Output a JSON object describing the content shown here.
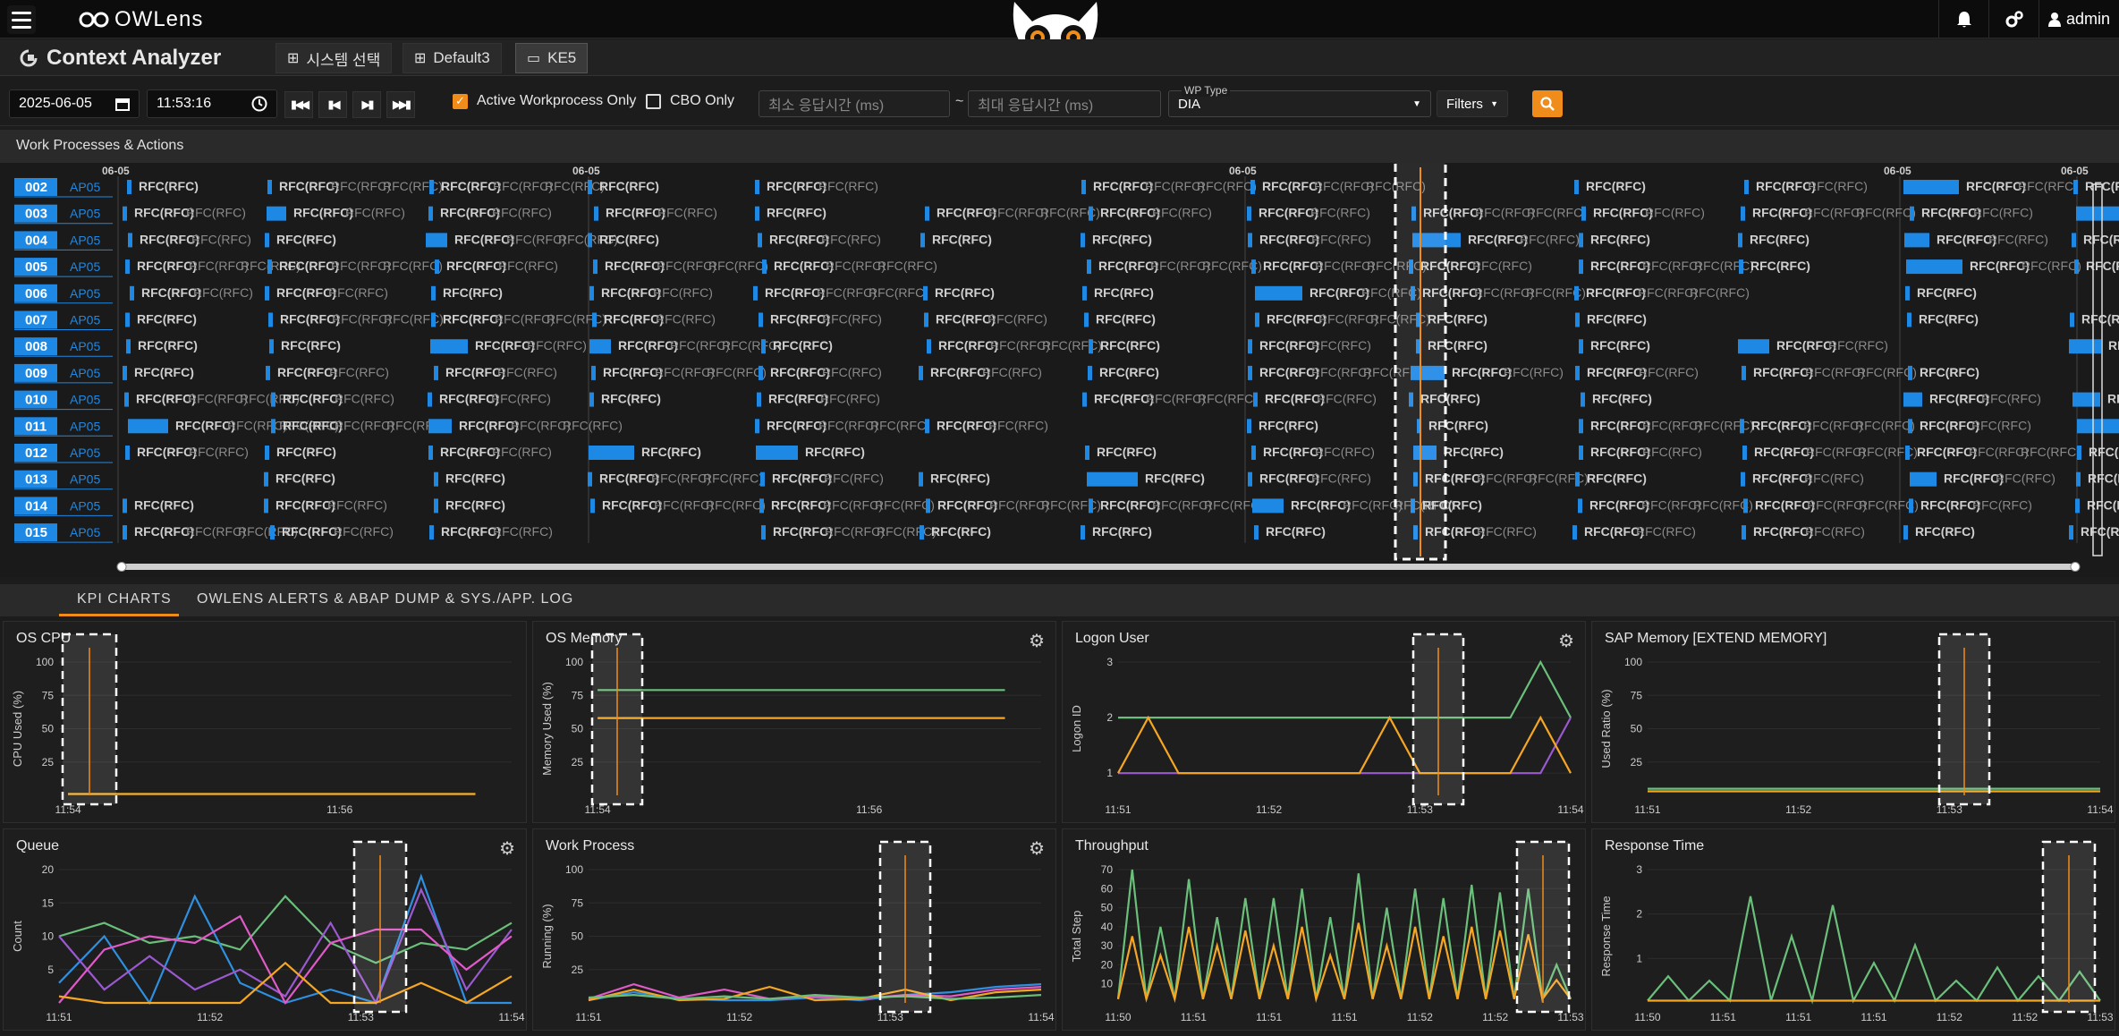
{
  "app": {
    "title": "OWLens"
  },
  "topbar": {
    "admin_label": "admin"
  },
  "subbar": {
    "title": "Context Analyzer",
    "tabs": [
      {
        "label": "시스템 선택"
      },
      {
        "label": "Default3"
      },
      {
        "label": "KE5"
      }
    ]
  },
  "toolbar": {
    "date": "2025-06-05",
    "time": "11:53:16",
    "active_wp_label": "Active Workprocess Only",
    "active_wp_checked": true,
    "cbo_label": "CBO Only",
    "cbo_checked": false,
    "min_resp_placeholder": "최소 응답시간 (ms)",
    "tilde": "~",
    "max_resp_placeholder": "최대 응답시간 (ms)",
    "wp_type_label": "WP Type",
    "wp_type_value": "DIA",
    "filters_label": "Filters"
  },
  "workprocess": {
    "title": "Work Processes & Actions",
    "date_labels": [
      "06-05",
      "06-05",
      "06-05",
      "06-05",
      "06-05"
    ],
    "rows": [
      {
        "id": "002",
        "server": "AP05"
      },
      {
        "id": "003",
        "server": "AP05"
      },
      {
        "id": "004",
        "server": "AP05"
      },
      {
        "id": "005",
        "server": "AP05"
      },
      {
        "id": "006",
        "server": "AP05"
      },
      {
        "id": "007",
        "server": "AP05"
      },
      {
        "id": "008",
        "server": "AP05"
      },
      {
        "id": "009",
        "server": "AP05"
      },
      {
        "id": "010",
        "server": "AP05"
      },
      {
        "id": "011",
        "server": "AP05"
      },
      {
        "id": "012",
        "server": "AP05"
      },
      {
        "id": "013",
        "server": "AP05"
      },
      {
        "id": "014",
        "server": "AP05"
      },
      {
        "id": "015",
        "server": "AP05"
      }
    ],
    "action_label": "RFC(RFC)"
  },
  "bottom_tabs": [
    {
      "label": "KPI CHARTS",
      "active": true
    },
    {
      "label": "OWLENS ALERTS & ABAP DUMP & SYS./APP. LOG",
      "active": false
    }
  ],
  "colors": {
    "accent": "#f08c1a",
    "wp_blue": "#1e88e5",
    "green": "#6abf7a",
    "yellow": "#f5a623",
    "purple": "#9b59d0",
    "pink": "#e05ac8",
    "blue": "#2f8fe0"
  },
  "chart_data": [
    {
      "type": "line",
      "title": "OS CPU",
      "ylabel": "CPU Used (%)",
      "yticks": [
        "100",
        "75",
        "50",
        "25"
      ],
      "ylim": [
        0,
        100
      ],
      "xticks": [
        "11:54",
        "11:56"
      ],
      "series": [
        {
          "color": "#6abf7a",
          "values": [
            1,
            1
          ]
        },
        {
          "color": "#f5a623",
          "values": [
            1,
            1
          ]
        }
      ]
    },
    {
      "type": "line",
      "title": "OS Memory",
      "ylabel": "Memory Used (%)",
      "yticks": [
        "100",
        "75",
        "50",
        "25"
      ],
      "ylim": [
        0,
        100
      ],
      "xticks": [
        "11:54",
        "11:56"
      ],
      "series": [
        {
          "color": "#6abf7a",
          "values": [
            79,
            79
          ]
        },
        {
          "color": "#f5a623",
          "values": [
            58,
            58
          ]
        }
      ]
    },
    {
      "type": "line",
      "title": "Logon User",
      "ylabel": "Logon ID",
      "yticks": [
        "3",
        "2",
        "1"
      ],
      "ylim": [
        0.6,
        3
      ],
      "xticks": [
        "11:51",
        "11:52",
        "11:53",
        "11:54"
      ],
      "series": [
        {
          "color": "#9b59d0",
          "values": [
            1,
            1,
            1,
            1,
            1,
            1,
            1,
            1,
            1,
            1,
            1,
            1,
            1,
            1,
            1,
            2
          ]
        },
        {
          "color": "#6abf7a",
          "values": [
            2,
            2,
            2,
            2,
            2,
            2,
            2,
            2,
            2,
            2,
            2,
            2,
            2,
            2,
            3,
            2
          ]
        },
        {
          "color": "#f5a623",
          "values": [
            1,
            2,
            1,
            1,
            1,
            1,
            1,
            1,
            1,
            2,
            1,
            1,
            1,
            1,
            2,
            1
          ]
        }
      ]
    },
    {
      "type": "line",
      "title": "SAP Memory [EXTEND MEMORY]",
      "ylabel": "Used Ratio (%)",
      "yticks": [
        "100",
        "75",
        "50",
        "25"
      ],
      "ylim": [
        0,
        100
      ],
      "xticks": [
        "11:51",
        "11:52",
        "11:53",
        "11:54"
      ],
      "series": [
        {
          "color": "#6abf7a",
          "values": [
            5,
            5
          ]
        },
        {
          "color": "#f5a623",
          "values": [
            3,
            3
          ]
        }
      ]
    },
    {
      "type": "line",
      "title": "Queue",
      "ylabel": "Count",
      "yticks": [
        "20",
        "15",
        "10",
        "5"
      ],
      "ylim": [
        0,
        20
      ],
      "xticks": [
        "11:51",
        "11:52",
        "11:53",
        "11:54"
      ],
      "series": [
        {
          "color": "#6abf7a",
          "values": [
            10,
            12,
            9,
            10,
            8,
            16,
            9,
            6,
            9,
            8,
            12
          ]
        },
        {
          "color": "#2f8fe0",
          "values": [
            3,
            10,
            0,
            16,
            3,
            0,
            2,
            0,
            19,
            0,
            0
          ]
        },
        {
          "color": "#9b59d0",
          "values": [
            10,
            2,
            7,
            2,
            5,
            1,
            12,
            0,
            17,
            2,
            11
          ]
        },
        {
          "color": "#e05ac8",
          "values": [
            0,
            8,
            10,
            9,
            13,
            0,
            9,
            11,
            11,
            5,
            10
          ]
        },
        {
          "color": "#f5a623",
          "values": [
            1,
            0,
            0,
            0,
            0,
            6,
            0,
            0,
            3,
            0,
            4
          ]
        }
      ]
    },
    {
      "type": "line",
      "title": "Work Process",
      "ylabel": "Running (%)",
      "yticks": [
        "100",
        "75",
        "50",
        "25"
      ],
      "ylim": [
        0,
        100
      ],
      "xticks": [
        "11:51",
        "11:52",
        "11:53",
        "11:54"
      ],
      "series": [
        {
          "color": "#2f8fe0",
          "values": [
            2,
            8,
            3,
            2,
            2,
            4,
            2,
            6,
            8,
            12,
            14
          ]
        },
        {
          "color": "#e05ac8",
          "values": [
            3,
            14,
            4,
            10,
            3,
            5,
            3,
            6,
            5,
            10,
            12
          ]
        },
        {
          "color": "#f5a623",
          "values": [
            2,
            10,
            2,
            3,
            12,
            2,
            3,
            10,
            2,
            8,
            10
          ]
        },
        {
          "color": "#6abf7a",
          "values": [
            4,
            6,
            3,
            5,
            3,
            6,
            4,
            5,
            3,
            4,
            6
          ]
        }
      ]
    },
    {
      "type": "line",
      "title": "Throughput",
      "ylabel": "Total Step",
      "yticks": [
        "70",
        "60",
        "50",
        "40",
        "30",
        "20",
        "10"
      ],
      "ylim": [
        0,
        70
      ],
      "xticks": [
        "11:50",
        "11:51",
        "11:51",
        "11:51",
        "11:52",
        "11:52",
        "11:53"
      ],
      "series": [
        {
          "color": "#6abf7a",
          "values": [
            2,
            70,
            2,
            40,
            2,
            65,
            2,
            45,
            2,
            55,
            2,
            55,
            2,
            60,
            2,
            45,
            2,
            68,
            2,
            50,
            2,
            60,
            2,
            55,
            2,
            62,
            2,
            58,
            2,
            60,
            2,
            20,
            2
          ]
        },
        {
          "color": "#f5a623",
          "values": [
            2,
            35,
            2,
            25,
            2,
            40,
            2,
            30,
            2,
            38,
            2,
            30,
            2,
            40,
            2,
            25,
            2,
            42,
            2,
            30,
            2,
            40,
            2,
            35,
            2,
            40,
            2,
            38,
            2,
            36,
            2,
            12,
            2
          ]
        }
      ]
    },
    {
      "type": "line",
      "title": "Response Time",
      "ylabel": "Response Time",
      "yticks": [
        "3",
        "2",
        "1"
      ],
      "ylim": [
        0,
        3
      ],
      "xticks": [
        "11:50",
        "11:51",
        "11:51",
        "11:51",
        "11:52",
        "11:52",
        "11:53"
      ],
      "series": [
        {
          "color": "#6abf7a",
          "values": [
            0.05,
            0.6,
            0.05,
            0.5,
            0.05,
            2.4,
            0.05,
            1.5,
            0.05,
            2.2,
            0.05,
            0.9,
            0.05,
            1.3,
            0.05,
            0.5,
            0.05,
            0.8,
            0.05,
            0.6,
            0.05,
            0.7,
            0.05
          ]
        },
        {
          "color": "#f5a623",
          "values": [
            0.05,
            0.05,
            0.05,
            0.05,
            0.05,
            0.05,
            0.05,
            0.05,
            0.05,
            0.05,
            0.05,
            0.05,
            0.05,
            0.05,
            0.05,
            0.05,
            0.05,
            0.05,
            0.05,
            0.05,
            0.05,
            0.05,
            0.05
          ]
        }
      ]
    }
  ]
}
